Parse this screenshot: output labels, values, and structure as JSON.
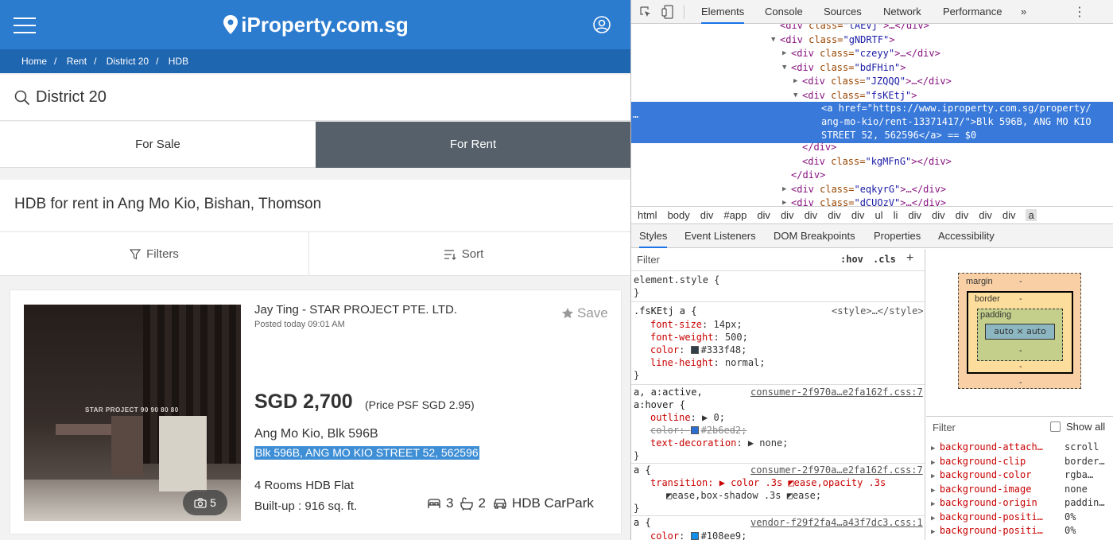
{
  "site": {
    "logo_text": "iProperty.com.sg",
    "breadcrumb": [
      "Home",
      "Rent",
      "District 20",
      "HDB"
    ],
    "search_value": "District 20",
    "tabs": {
      "sale": "For Sale",
      "rent": "For Rent"
    },
    "headline": "HDB for rent in Ang Mo Kio, Bishan, Thomson",
    "filters_label": "Filters",
    "sort_label": "Sort",
    "listing": {
      "agent": "Jay Ting - STAR PROJECT PTE. LTD.",
      "posted": "Posted today 09:01 AM",
      "save_label": "Save",
      "watermark": "STAR PROJECT 90 90 80 80",
      "photo_count": "5",
      "price": "SGD 2,700",
      "psf": "(Price PSF SGD 2.95)",
      "locality": "Ang Mo Kio, Blk 596B",
      "address": "Blk 596B, ANG MO KIO STREET 52, 562596",
      "flat_type": "4 Rooms HDB Flat",
      "builtup": "Built-up : 916 sq. ft.",
      "beds": "3",
      "baths": "2",
      "parking": "HDB CarPark"
    },
    "colors": {
      "brand": "#2b7bcf",
      "breadcrumb_bg": "#1f66b0",
      "active_tab": "#55606a",
      "address_highlight": "#3f8fd6"
    }
  },
  "devtools": {
    "tabs": [
      "Elements",
      "Console",
      "Sources",
      "Network",
      "Performance",
      "»"
    ],
    "dom_lines": [
      {
        "indent": 0,
        "open": "<div class=",
        "cls": "\"tAEVj\"",
        "tail": ">…</div>"
      },
      {
        "indent": 0,
        "arrow": "▼",
        "open": "<div class=",
        "cls": "\"gNDRTF\"",
        "tail": ">"
      },
      {
        "indent": 1,
        "arrow": "▶",
        "open": "<div class=",
        "cls": "\"czeyy\"",
        "tail": ">…</div>"
      },
      {
        "indent": 1,
        "arrow": "▼",
        "open": "<div class=",
        "cls": "\"bdFHin\"",
        "tail": ">"
      },
      {
        "indent": 2,
        "arrow": "▶",
        "open": "<div class=",
        "cls": "\"JZQQQ\"",
        "tail": ">…</div>"
      },
      {
        "indent": 2,
        "arrow": "▼",
        "open": "<div class=",
        "cls": "\"fsKEtj\"",
        "tail": ">"
      }
    ],
    "selected_lines": [
      "<a href=\"https://www.iproperty.com.sg/property/",
      "ang-mo-kio/rent-13371417/\">Blk 596B, ANG MO KIO",
      "STREET 52, 562596</a> == $0"
    ],
    "dom_after": [
      {
        "indent": 2,
        "text": "</div>"
      },
      {
        "indent": 2,
        "open": "<div class=",
        "cls": "\"kgMFnG\"",
        "tail": "></div>"
      },
      {
        "indent": 1,
        "text": "</div>"
      },
      {
        "indent": 1,
        "arrow": "▶",
        "open": "<div class=",
        "cls": "\"eqkyrG\"",
        "tail": ">…</div>"
      },
      {
        "indent": 1,
        "arrow": "▶",
        "open": "<div class=",
        "cls": "\"dCUOzV\"",
        "tail": ">…</div>"
      }
    ],
    "crumbs": [
      "html",
      "body",
      "div",
      "#app",
      "div",
      "div",
      "div",
      "div",
      "div",
      "ul",
      "li",
      "div",
      "div",
      "div",
      "div",
      "div",
      "a"
    ],
    "subtabs": [
      "Styles",
      "Event Listeners",
      "DOM Breakpoints",
      "Properties",
      "Accessibility"
    ],
    "filter_placeholder": "Filter",
    "hov": ":hov",
    "cls": ".cls",
    "styles": {
      "element_style": "element.style {",
      "rule1_sel": ".fsKEtj a {",
      "rule1_src": "<style>…</style>",
      "rule1_props": [
        [
          "font-size",
          "14px;"
        ],
        [
          "font-weight",
          "500;"
        ],
        [
          "color",
          "#333f48;"
        ],
        [
          "line-height",
          "normal;"
        ]
      ],
      "rule2_sel": "a, a:active,",
      "rule2_sel2": "a:hover {",
      "rule2_src": "consumer-2f970a…e2fa162f.css:7",
      "rule2_props": [
        [
          "outline",
          "▶ 0;"
        ],
        [
          "color",
          "#2b6ed2;"
        ],
        [
          "text-decoration",
          "▶ none;"
        ]
      ],
      "rule3_sel": "a {",
      "rule3_src": "consumer-2f970a…e2fa162f.css:7",
      "rule3_line1": "transition: ▶ color .3s ◩ease,opacity .3s",
      "rule3_line2": "◩ease,box-shadow .3s ◩ease;",
      "rule4_sel": "a {",
      "rule4_src": "vendor-f29f2fa4…a43f7dc3.css:1",
      "rule4_prop": [
        "color",
        "#108ee9;"
      ]
    },
    "boxmodel": {
      "margin": "margin",
      "border": "border",
      "padding": "padding",
      "content": "auto × auto",
      "dash": "-"
    },
    "computed_filter": "Filter",
    "show_all": "Show all",
    "computed": [
      [
        "background-attach…",
        "scroll"
      ],
      [
        "background-clip",
        "border…"
      ],
      [
        "background-color",
        "rgba…"
      ],
      [
        "background-image",
        "none"
      ],
      [
        "background-origin",
        "paddin…"
      ],
      [
        "background-positi…",
        "0%"
      ],
      [
        "background-positi…",
        "0%"
      ]
    ]
  }
}
